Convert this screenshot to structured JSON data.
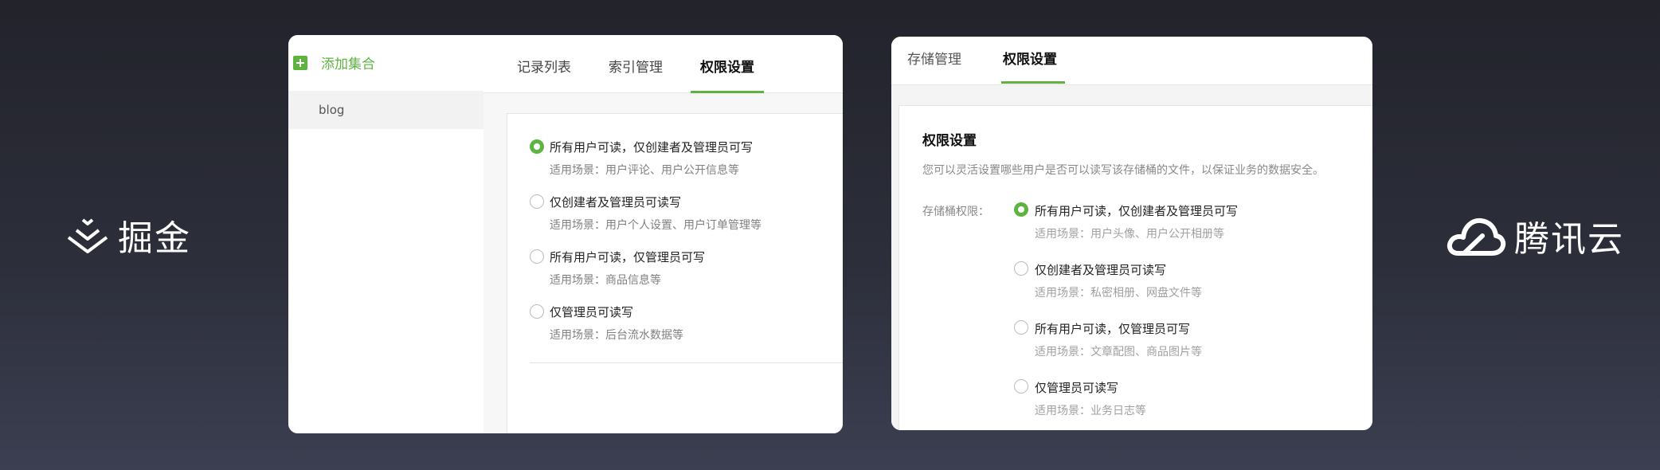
{
  "brands": {
    "left": {
      "name": "掘金"
    },
    "right": {
      "name": "腾讯云"
    }
  },
  "left_panel": {
    "sidebar": {
      "add_label": "添加集合",
      "items": [
        {
          "label": "blog"
        }
      ]
    },
    "tabs": [
      {
        "label": "记录列表"
      },
      {
        "label": "索引管理"
      },
      {
        "label": "权限设置",
        "active": true
      }
    ],
    "options": [
      {
        "label": "所有用户可读，仅创建者及管理员可写",
        "desc": "适用场景：用户评论、用户公开信息等",
        "checked": true
      },
      {
        "label": "仅创建者及管理员可读写",
        "desc": "适用场景：用户个人设置、用户订单管理等",
        "checked": false
      },
      {
        "label": "所有用户可读，仅管理员可写",
        "desc": "适用场景：商品信息等",
        "checked": false
      },
      {
        "label": "仅管理员可读写",
        "desc": "适用场景：后台流水数据等",
        "checked": false
      }
    ]
  },
  "right_panel": {
    "tabs": [
      {
        "label": "存储管理"
      },
      {
        "label": "权限设置",
        "active": true
      }
    ],
    "section_title": "权限设置",
    "description": "您可以灵活设置哪些用户是否可以读写该存储桶的文件，以保证业务的数据安全。",
    "field_label": "存储桶权限：",
    "options": [
      {
        "label": "所有用户可读，仅创建者及管理员可写",
        "desc": "适用场景：用户头像、用户公开相册等",
        "checked": true
      },
      {
        "label": "仅创建者及管理员可读写",
        "desc": "适用场景：私密相册、网盘文件等",
        "checked": false
      },
      {
        "label": "所有用户可读，仅管理员可写",
        "desc": "适用场景：文章配图、商品图片等",
        "checked": false
      },
      {
        "label": "仅管理员可读写",
        "desc": "适用场景：业务日志等",
        "checked": false
      }
    ]
  },
  "colors": {
    "accent": "#5fb341",
    "background_top": "#22232b",
    "background_bottom": "#3b3f51"
  }
}
